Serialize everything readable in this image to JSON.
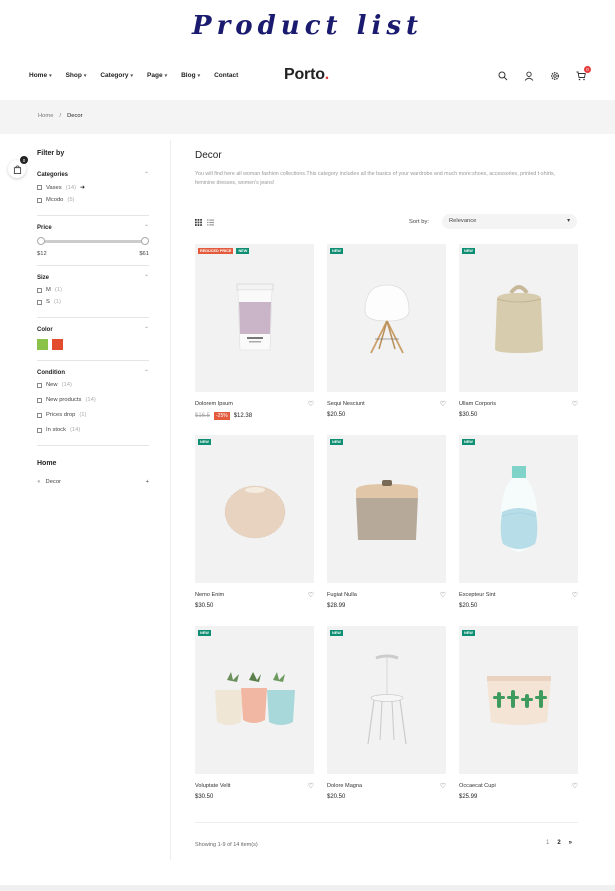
{
  "banner": {
    "title": "Product list"
  },
  "header": {
    "nav": [
      {
        "label": "Home"
      },
      {
        "label": "Shop"
      },
      {
        "label": "Category"
      },
      {
        "label": "Page"
      },
      {
        "label": "Blog"
      },
      {
        "label": "Contact"
      }
    ],
    "logo": "Porto",
    "logo_dot": ".",
    "cart_count": "0",
    "icons": [
      "search-icon",
      "user-icon",
      "settings-icon",
      "cart-icon"
    ]
  },
  "breadcrumb": {
    "home": "Home",
    "separator": "/",
    "current": "Decor"
  },
  "side_cart": {
    "count": "0"
  },
  "sidebar": {
    "title": "Filter by",
    "categories": {
      "title": "Categories",
      "items": [
        {
          "label": "Vases",
          "count": "(14)"
        },
        {
          "label": "Mcodo",
          "count": "(5)"
        }
      ]
    },
    "price": {
      "title": "Price",
      "min": "$12",
      "max": "$61"
    },
    "size": {
      "title": "Size",
      "items": [
        {
          "label": "M",
          "count": "(1)"
        },
        {
          "label": "S",
          "count": "(1)"
        }
      ]
    },
    "color": {
      "title": "Color",
      "swatches": [
        "#8bc34a",
        "#e34b2f"
      ]
    },
    "condition": {
      "title": "Condition",
      "items": [
        {
          "label": "New",
          "count": "(14)"
        },
        {
          "label": "New products",
          "count": "(14)"
        },
        {
          "label": "Prices drop",
          "count": "(1)"
        },
        {
          "label": "In stock",
          "count": "(14)"
        }
      ]
    },
    "home": {
      "title": "Home",
      "item": "Decor",
      "plus": "+"
    }
  },
  "main": {
    "title": "Decor",
    "description": "You will find here all woman fashion collections.This category includes all the basics of your wardrobe and much more:shoes, accessories, printed t-shirts, feminine dresses, women's jeans!",
    "sort_label": "Sort by:",
    "sort_value": "Relevance",
    "showing": "Showing 1-9 of 14 item(s)",
    "pages": [
      "1",
      "2"
    ],
    "next": "»"
  },
  "products": [
    {
      "name": "Dolorem Ipsum",
      "price": "$12.38",
      "old_price": "$16.5",
      "discount": "-25%",
      "labels": [
        "REDUCED PRICE",
        "NEW"
      ]
    },
    {
      "name": "Sequi Nesciunt",
      "price": "$20.50",
      "labels": [
        "NEW"
      ]
    },
    {
      "name": "Ullam Corporis",
      "price": "$30.50",
      "labels": [
        "NEW"
      ]
    },
    {
      "name": "Nemo Enim",
      "price": "$30.50",
      "labels": [
        "NEW"
      ]
    },
    {
      "name": "Fugiat Nulla",
      "price": "$28.99",
      "labels": [
        "NEW"
      ]
    },
    {
      "name": "Excepteur Sint",
      "price": "$20.50",
      "labels": [
        "NEW"
      ]
    },
    {
      "name": "Voluptate Velit",
      "price": "$30.50",
      "labels": [
        "NEW"
      ]
    },
    {
      "name": "Dolore Magna",
      "price": "$20.50",
      "labels": [
        "NEW"
      ]
    },
    {
      "name": "Occaecat Cupi",
      "price": "$25.99",
      "labels": [
        "NEW"
      ]
    }
  ]
}
